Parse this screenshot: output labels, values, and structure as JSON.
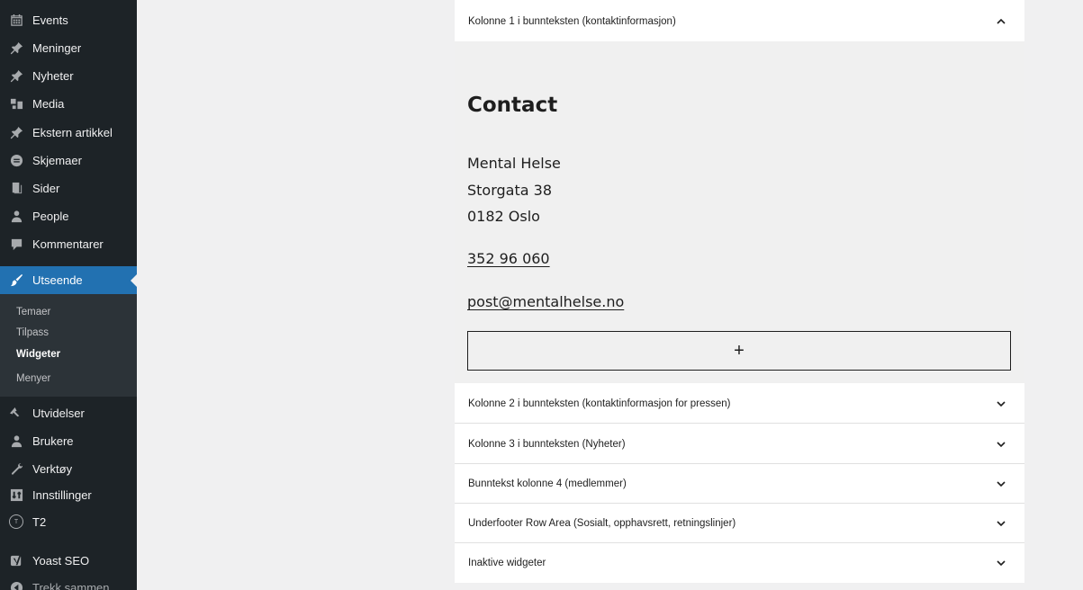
{
  "sidebar": {
    "items": [
      {
        "label": "Events",
        "icon": "calendar-icon"
      },
      {
        "label": "Meninger",
        "icon": "pin-icon"
      },
      {
        "label": "Nyheter",
        "icon": "pin-icon"
      },
      {
        "label": "Media",
        "icon": "media-icon"
      },
      {
        "label": "Ekstern artikkel",
        "icon": "pin-icon"
      },
      {
        "label": "Skjemaer",
        "icon": "forms-icon"
      },
      {
        "label": "Sider",
        "icon": "pages-icon"
      },
      {
        "label": "People",
        "icon": "people-icon"
      },
      {
        "label": "Kommentarer",
        "icon": "comment-icon"
      },
      {
        "label": "Utseende",
        "icon": "appearance-icon"
      },
      {
        "label": "Utvidelser",
        "icon": "plugin-icon"
      },
      {
        "label": "Brukere",
        "icon": "users-icon"
      },
      {
        "label": "Verktøy",
        "icon": "wrench-icon"
      },
      {
        "label": "Innstillinger",
        "icon": "settings-icon"
      },
      {
        "label": "T2",
        "icon": "t2-icon",
        "icon_text": "T"
      },
      {
        "label": "Yoast SEO",
        "icon": "yoast-icon"
      },
      {
        "label": "Trekk sammen",
        "icon": "collapse-icon"
      }
    ],
    "submenu": [
      "Temaer",
      "Tilpass",
      "Widgeter",
      "Menyer"
    ],
    "accent_color": "#2271b1",
    "background_color": "#1d2327"
  },
  "widgets": {
    "open_area": {
      "title": "Kolonne 1 i bunnteksten (kontaktinformasjon)",
      "heading": "Contact",
      "address": [
        "Mental Helse",
        "Storgata 38",
        "0182 Oslo"
      ],
      "phone": "352 96 060",
      "email": "post@mentalhelse.no",
      "add_block": "+"
    },
    "collapsed_areas": [
      "Kolonne 2 i bunnteksten (kontaktinformasjon for pressen)",
      "Kolonne 3 i bunnteksten (Nyheter)",
      "Bunntekst kolonne 4 (medlemmer)",
      "Underfooter Row Area (Sosialt, opphavsrett, retningslinjer)",
      "Inaktive widgeter"
    ]
  }
}
